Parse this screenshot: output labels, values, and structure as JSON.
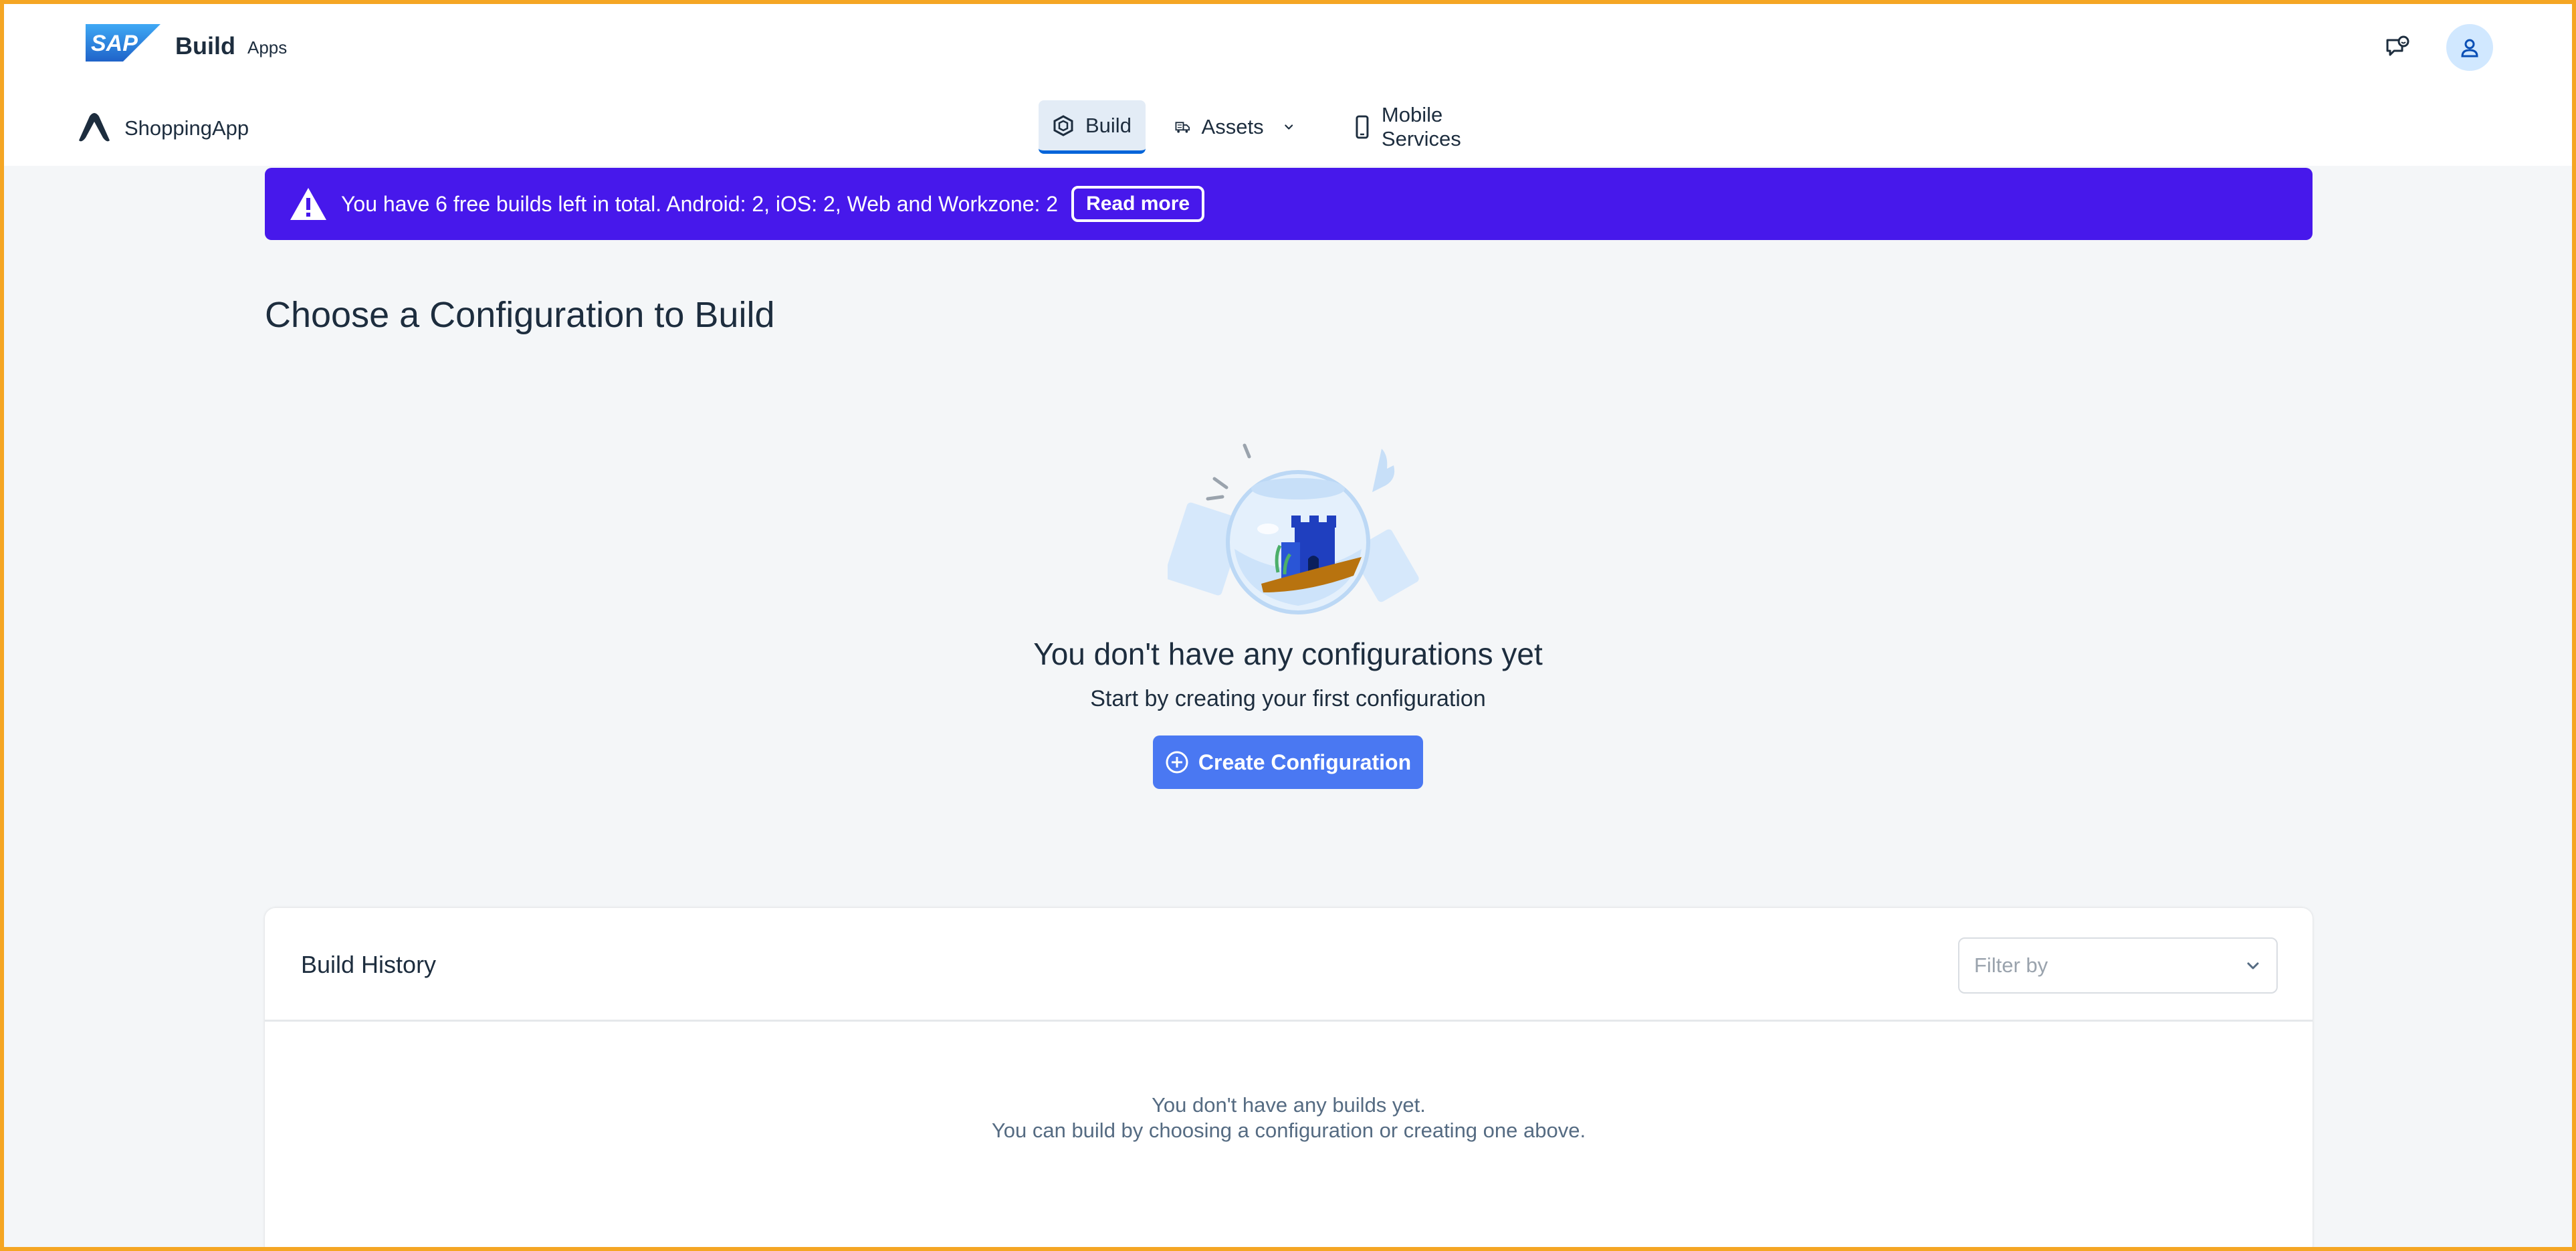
{
  "shell": {
    "logo_text": "SAP",
    "product_name": "Build",
    "product_sub": "Apps",
    "feedback_icon": "feedback-icon",
    "avatar_icon": "user-icon"
  },
  "nav": {
    "app_name": "ShoppingApp",
    "tabs": [
      {
        "label": "Build",
        "icon": "build-icon",
        "active": true
      },
      {
        "label": "Assets",
        "icon": "assets-icon",
        "active": false
      },
      {
        "label": "Mobile Services",
        "icon": "mobile-icon",
        "active": false
      }
    ]
  },
  "banner": {
    "text": "You have 6 free builds left in total. Android: 2, iOS: 2, Web and Workzone: 2",
    "read_more": "Read more",
    "color": "#4718eb"
  },
  "page": {
    "title": "Choose a Configuration to Build"
  },
  "empty_state": {
    "title": "You don't have any configurations yet",
    "subtitle": "Start by creating your first configuration",
    "button_label": "Create Configuration"
  },
  "history": {
    "title": "Build History",
    "filter_placeholder": "Filter by",
    "empty_line1": "You don't have any builds yet.",
    "empty_line2": "You can build by choosing a configuration or creating one above."
  },
  "colors": {
    "accent": "#4a78f2",
    "frame": "#f5a623",
    "text": "#1d2d3e"
  }
}
